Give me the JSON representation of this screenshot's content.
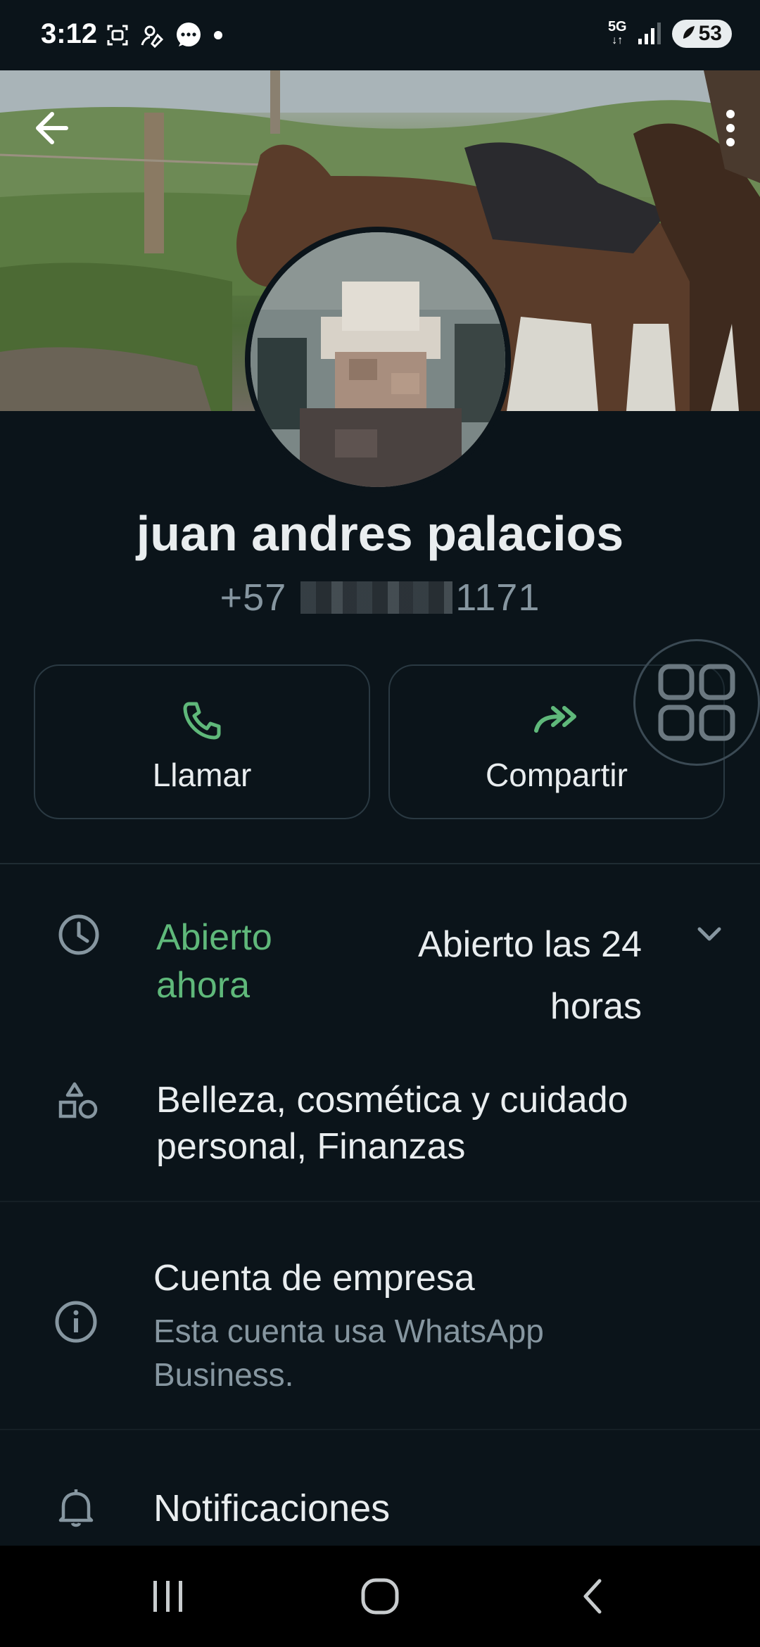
{
  "status_bar": {
    "time": "3:12",
    "network": "5G",
    "battery": "53"
  },
  "contact": {
    "name": "juan andres palacios",
    "phone_prefix": "+57",
    "phone_suffix": "1171"
  },
  "actions": {
    "call_label": "Llamar",
    "share_label": "Compartir"
  },
  "business_hours": {
    "status": "Abierto ahora",
    "value": "Abierto las 24 horas"
  },
  "categories": {
    "text": "Belleza, cosmética y cuidado personal, Finanzas"
  },
  "business_account": {
    "title": "Cuenta de empresa",
    "subtitle": "Esta cuenta usa WhatsApp Business."
  },
  "notifications": {
    "label": "Notificaciones"
  },
  "colors": {
    "background": "#0b141a",
    "accent_green": "#5fb87a",
    "secondary_text": "#8696a0"
  },
  "icons": [
    "back-arrow-icon",
    "more-vert-icon",
    "phone-icon",
    "share-forward-icon",
    "qr-grid-icon",
    "clock-icon",
    "category-shapes-icon",
    "info-icon",
    "bell-icon",
    "recents-icon",
    "home-icon",
    "nav-back-icon"
  ]
}
